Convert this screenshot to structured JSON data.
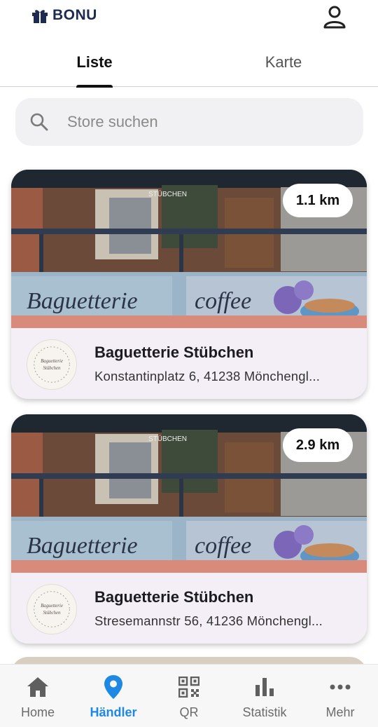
{
  "app": {
    "brand": "BONU"
  },
  "tabs": [
    {
      "label": "Liste",
      "active": true
    },
    {
      "label": "Karte",
      "active": false
    }
  ],
  "search": {
    "placeholder": "Store suchen",
    "value": ""
  },
  "photo_text": {
    "sign_left": "Baguetterie",
    "sign_right": "coffee",
    "window_sign": "STÜBCHEN"
  },
  "stores": [
    {
      "name": "Baguetterie Stübchen",
      "address": "Konstantinplatz 6, 41238 Mönchengl...",
      "distance": "1.1 km",
      "logo_text_1": "Baguetterie",
      "logo_text_2": "Stübchen"
    },
    {
      "name": "Baguetterie Stübchen",
      "address": "Stresemannstr 56, 41236 Mönchengl...",
      "distance": "2.9 km",
      "logo_text_1": "Baguetterie",
      "logo_text_2": "Stübchen"
    }
  ],
  "bottom_nav": [
    {
      "label": "Home",
      "icon": "home-icon",
      "active": false
    },
    {
      "label": "Händler",
      "icon": "location-pin-icon",
      "active": true
    },
    {
      "label": "QR",
      "icon": "qr-code-icon",
      "active": false
    },
    {
      "label": "Statistik",
      "icon": "bar-chart-icon",
      "active": false
    },
    {
      "label": "Mehr",
      "icon": "more-horizontal-icon",
      "active": false
    }
  ],
  "colors": {
    "accent": "#1e88e5",
    "brand": "#1d2b4f",
    "card_background": "#f4eff7",
    "search_background": "#f1f1f3"
  }
}
